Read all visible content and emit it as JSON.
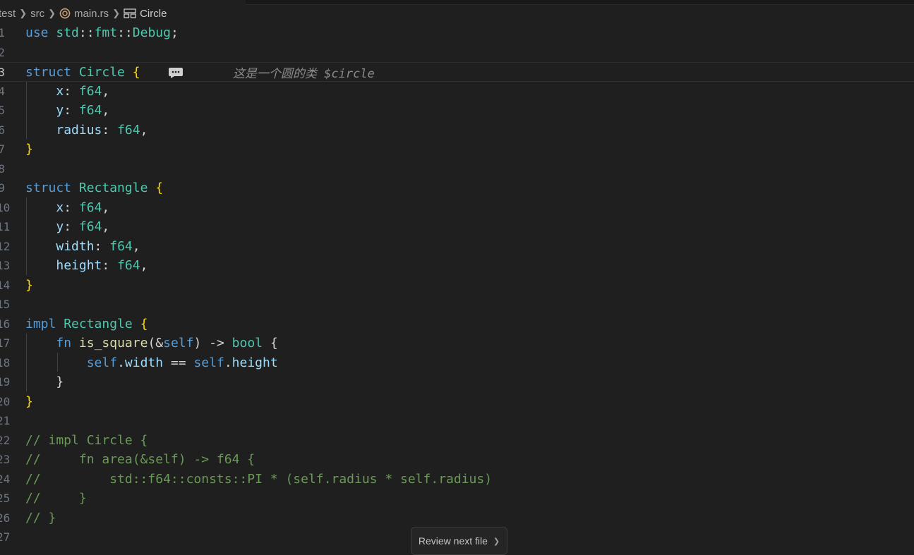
{
  "breadcrumb": {
    "items": [
      "test",
      "src",
      "main.rs",
      "Circle"
    ]
  },
  "editor": {
    "line_numbers": [
      "1",
      "2",
      "3",
      "4",
      "5",
      "6",
      "7",
      "8",
      "9",
      "10",
      "11",
      "12",
      "13",
      "14",
      "15",
      "16",
      "17",
      "18",
      "19",
      "20",
      "21",
      "22",
      "23",
      "24",
      "25",
      "26",
      "27"
    ],
    "active_line_number": "3",
    "lines": {
      "l1": [
        "use",
        " std",
        "::",
        "fmt",
        "::",
        "Debug",
        ";"
      ],
      "l3": [
        "struct",
        " ",
        "Circle",
        " ",
        "{"
      ],
      "l4": [
        "    ",
        "x",
        ": ",
        "f64",
        ","
      ],
      "l5": [
        "    ",
        "y",
        ": ",
        "f64",
        ","
      ],
      "l6": [
        "    ",
        "radius",
        ": ",
        "f64",
        ","
      ],
      "l7": [
        "}"
      ],
      "l9": [
        "struct",
        " ",
        "Rectangle",
        " ",
        "{"
      ],
      "l10": [
        "    ",
        "x",
        ": ",
        "f64",
        ","
      ],
      "l11": [
        "    ",
        "y",
        ": ",
        "f64",
        ","
      ],
      "l12": [
        "    ",
        "width",
        ": ",
        "f64",
        ","
      ],
      "l13": [
        "    ",
        "height",
        ": ",
        "f64",
        ","
      ],
      "l14": [
        "}"
      ],
      "l16": [
        "impl",
        " ",
        "Rectangle",
        " ",
        "{"
      ],
      "l17": [
        "    ",
        "fn",
        " ",
        "is_square",
        "(&",
        "self",
        ") -> ",
        "bool",
        " {"
      ],
      "l18": [
        "        ",
        "self",
        ".",
        "width",
        " == ",
        "self",
        ".",
        "height"
      ],
      "l19": [
        "    }"
      ],
      "l20": [
        "}"
      ],
      "l22": "// impl Circle {",
      "l23": "//     fn area(&self) -> f64 {",
      "l24": "//         std::f64::consts::PI * (self.radius * self.radius)",
      "l25": "//     }",
      "l26": "// }"
    },
    "inlay_hint": "这是一个圆的类 $circle",
    "inlay_icon": "comment-icon"
  },
  "review_button": {
    "label": "Review next file"
  },
  "colors": {
    "background": "#1f1f1f",
    "keyword": "#569cd6",
    "type": "#4ec9b0",
    "field": "#9cdcfe",
    "function": "#dcdcaa",
    "comment": "#6a9955",
    "bracket": "#ffd700"
  }
}
